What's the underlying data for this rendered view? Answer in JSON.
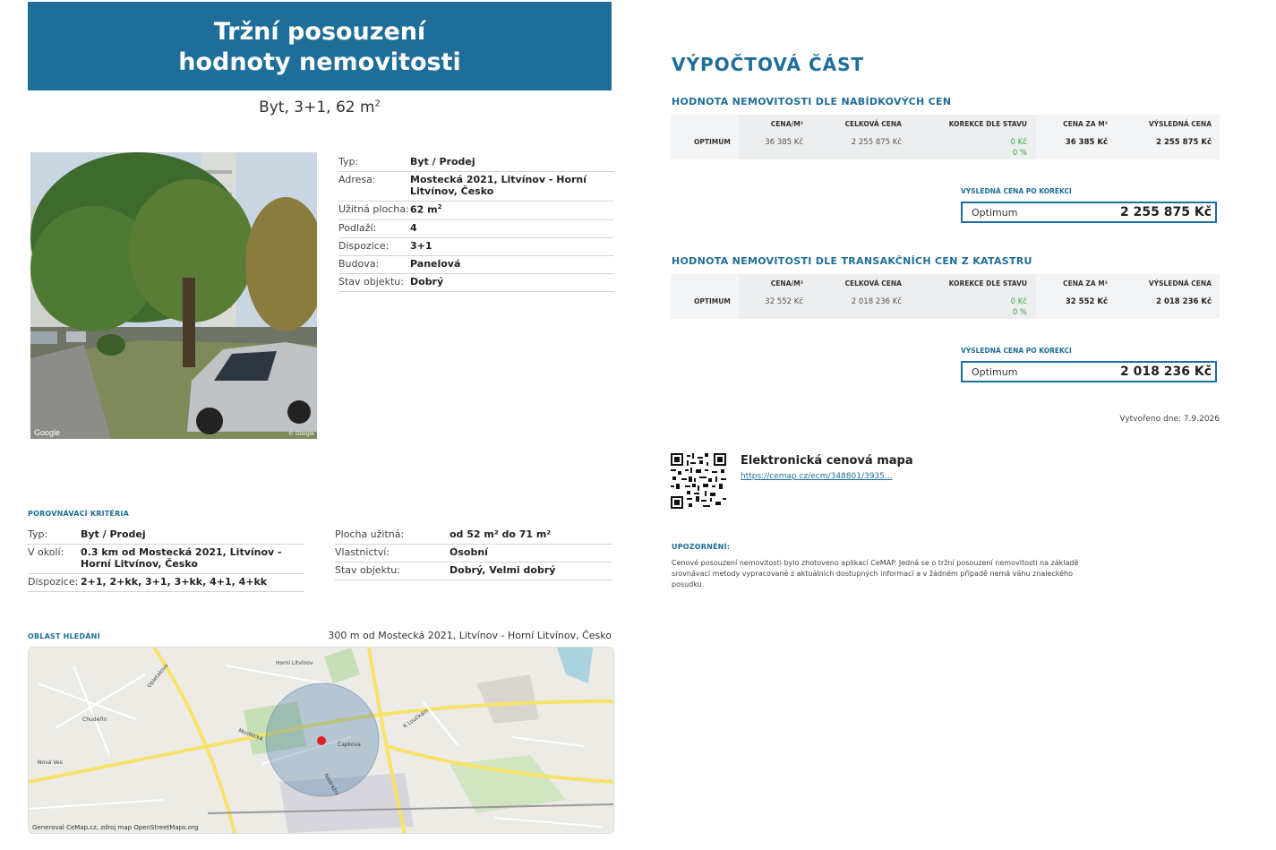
{
  "header": {
    "title_line1": "Tržní posouzení",
    "title_line2": "hodnoty nemovitosti"
  },
  "subtitle": {
    "text": "Byt, 3+1, 62 m",
    "sup": "2"
  },
  "photo": {
    "watermark_left": "Google",
    "watermark_right": "© Google"
  },
  "details": [
    {
      "key": "Typ:",
      "value": "Byt / Prodej"
    },
    {
      "key": "Adresa:",
      "value": "Mostecká 2021, Litvínov - Horní Litvínov, Česko"
    },
    {
      "key": "Užitná plocha:",
      "value": "62 m",
      "sup": "2"
    },
    {
      "key": "Podlaží:",
      "value": "4"
    },
    {
      "key": "Dispozice:",
      "value": "3+1"
    },
    {
      "key": "Budova:",
      "value": "Panelová"
    },
    {
      "key": "Stav objektu:",
      "value": "Dobrý"
    }
  ],
  "criteria": {
    "title": "POROVNÁVACÍ KRITÉRIA",
    "left": [
      {
        "key": "Typ:",
        "value": "Byt / Prodej"
      },
      {
        "key": "V okolí:",
        "value": "0.3 km od Mostecká 2021, Litvínov - Horní Litvínov, Česko"
      },
      {
        "key": "Dispozice:",
        "value": "2+1, 2+kk, 3+1, 3+kk, 4+1, 4+kk"
      }
    ],
    "right": [
      {
        "key": "Plocha užitná:",
        "value": "od 52 m² do 71 m²"
      },
      {
        "key": "Vlastnictví:",
        "value": "Osobní"
      },
      {
        "key": "Stav objektu:",
        "value": "Dobrý, Velmi dobrý"
      }
    ]
  },
  "area": {
    "title": "OBLAST HLEDÁNÍ",
    "address": "300 m od Mostecká 2021, Litvínov - Horní Litvínov, Česko",
    "map_credit": "Generoval CeMap.cz, zdroj map OpenStreetMaps.org",
    "labels": [
      "Horní Litvínov",
      "Mostecká",
      "Nádražní",
      "Čapkova",
      "Opletalova",
      "K Loučkám",
      "Nová Ves",
      "Chudeřín"
    ]
  },
  "calc": {
    "title": "VÝPOČTOVÁ ČÁST",
    "headers": {
      "cena_m2": "CENA/M²",
      "celkova": "CELKOVÁ CENA",
      "korekce": "KOREKCE DLE STAVU",
      "cena_za_m2": "CENA ZA M²",
      "vysledna": "VÝSLEDNÁ CENA"
    },
    "result_label": "VÝSLEDNÁ CENA PO KOREKCI",
    "sections": [
      {
        "title": "HODNOTA NEMOVITOSTI DLE NABÍDKOVÝCH CEN",
        "row_label": "OPTIMUM",
        "cena_m2": "36 385 Kč",
        "celkova": "2 255 875 Kč",
        "korekce_kc": "0 Kč",
        "korekce_pct": "0 %",
        "cena_za_m2": "36 385 Kč",
        "vysledna": "2 255 875 Kč",
        "result_name": "Optimum",
        "result_price": "2 255 875 Kč"
      },
      {
        "title": "HODNOTA NEMOVITOSTI DLE TRANSAKČNÍCH CEN Z KATASTRU",
        "row_label": "OPTIMUM",
        "cena_m2": "32 552 Kč",
        "celkova": "2 018 236 Kč",
        "korekce_kc": "0 Kč",
        "korekce_pct": "0 %",
        "cena_za_m2": "32 552 Kč",
        "vysledna": "2 018 236 Kč",
        "result_name": "Optimum",
        "result_price": "2 018 236 Kč"
      }
    ],
    "created": "Vytvořeno dne: 7.9.2026"
  },
  "ecm": {
    "title": "Elektronická cenová mapa",
    "url": "https://cemap.cz/ecm/348801/3935..."
  },
  "warning": {
    "title": "UPOZORNĚNÍ:",
    "text": "Cenové posouzení nemovitosti bylo zhotoveno aplikací CeMAP. Jedná se o tržní posouzení nemovitosti na základě srovnávací metody vypracované z aktuálních dostupných informací a v žádném případě nemá váhu znaleckého posudku."
  },
  "colors": {
    "brand": "#1e6e99",
    "green": "#3aa83a",
    "table_bg": "#eceeef"
  }
}
